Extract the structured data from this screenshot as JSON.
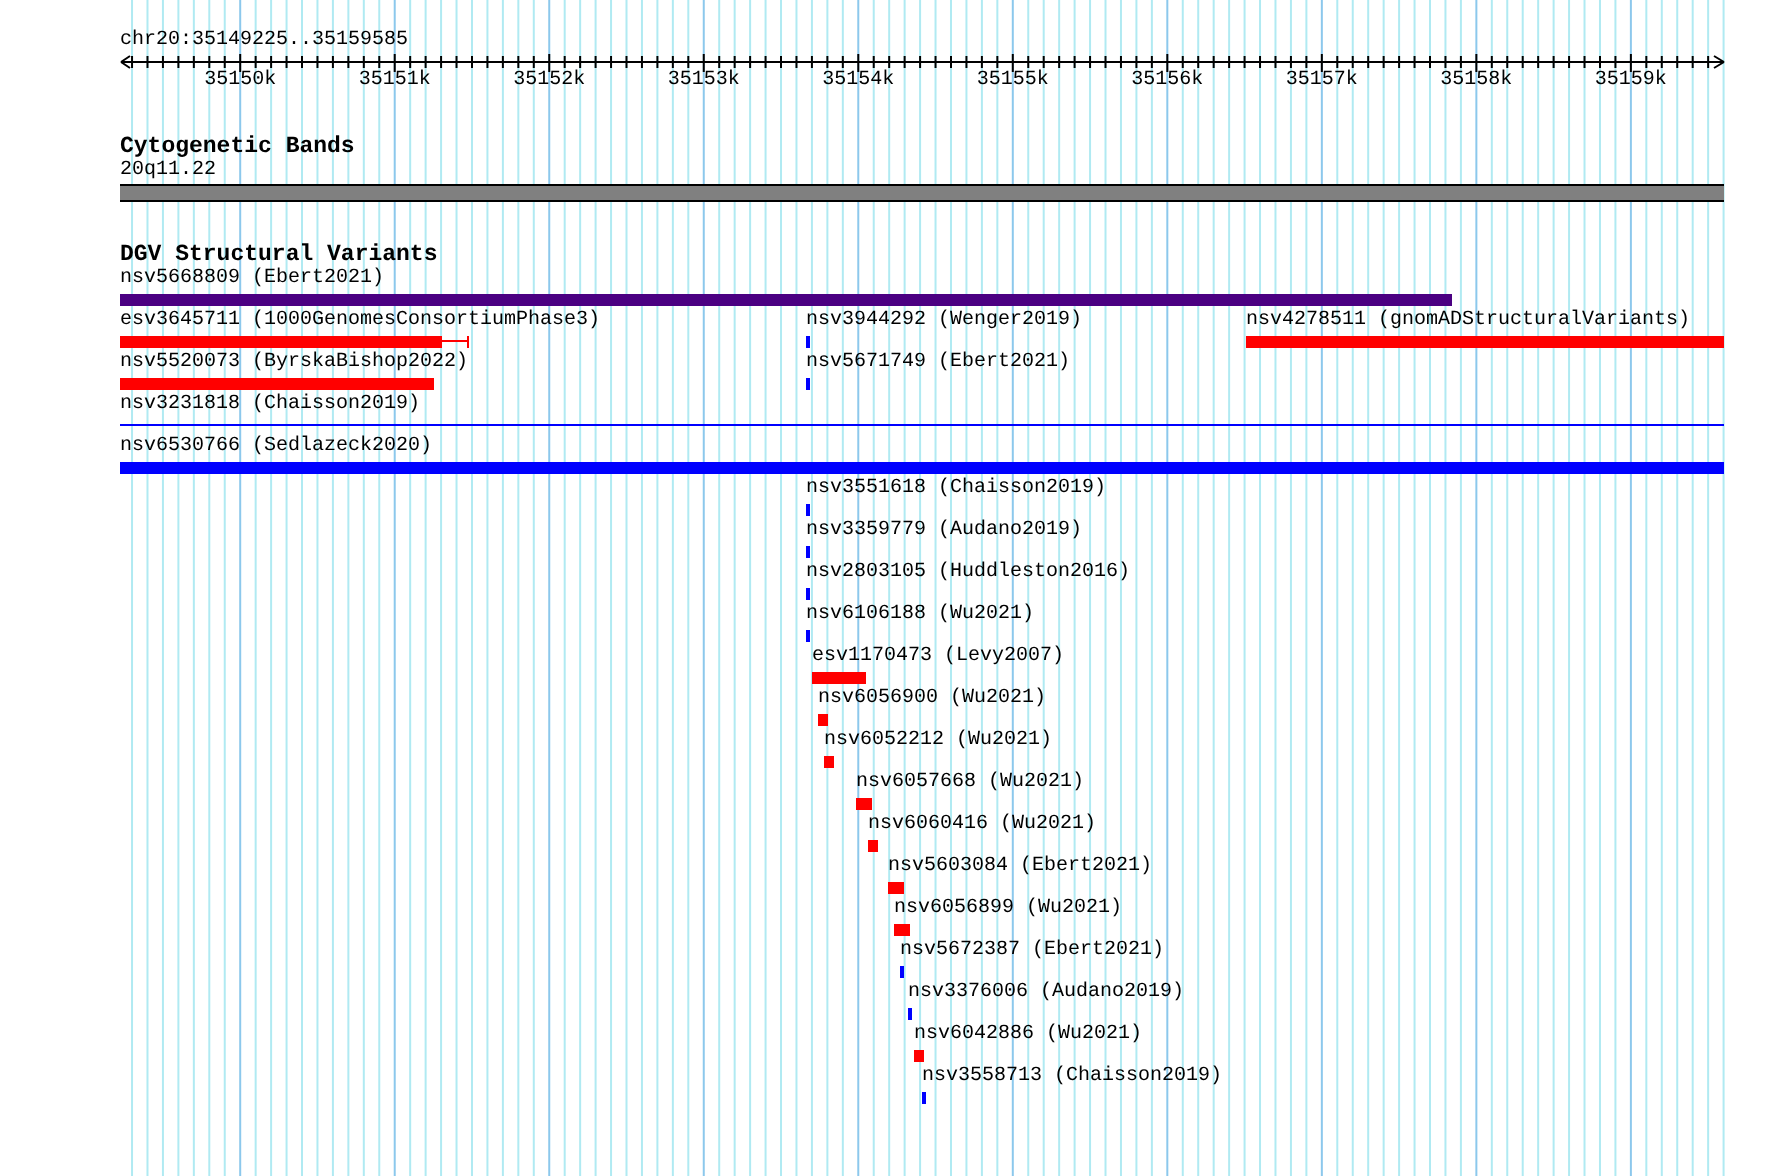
{
  "ruler": {
    "location": "chr20:35149225..35159585",
    "ticks": [
      "35150k",
      "35151k",
      "35152k",
      "35153k",
      "35154k",
      "35155k",
      "35156k",
      "35157k",
      "35158k",
      "35159k"
    ]
  },
  "tracks": [
    {
      "title": "Cytogenetic Bands",
      "kind": "bands",
      "features": [
        {
          "label": "20q11.22",
          "color": "#808080"
        }
      ]
    },
    {
      "title": "DGV Structural Variants",
      "kind": "variants",
      "features": [
        {
          "label": "nsv5668809 (Ebert2021)",
          "kind": "bar",
          "color": "#4b0082"
        },
        {
          "label": "esv3645711 (1000GenomesConsortiumPhase3)",
          "kind": "bar_whisker",
          "color": "#ff0000"
        },
        {
          "label": "nsv3944292 (Wenger2019)",
          "kind": "bar",
          "color": "#0000ff"
        },
        {
          "label": "nsv4278511 (gnomADStructuralVariants)",
          "kind": "bar",
          "color": "#ff0000"
        },
        {
          "label": "nsv5520073 (ByrskaBishop2022)",
          "kind": "bar",
          "color": "#ff0000"
        },
        {
          "label": "nsv5671749 (Ebert2021)",
          "kind": "bar",
          "color": "#0000ff"
        },
        {
          "label": "nsv3231818 (Chaisson2019)",
          "kind": "line",
          "color": "#0000ff"
        },
        {
          "label": "nsv6530766 (Sedlazeck2020)",
          "kind": "bar",
          "color": "#0000ff"
        },
        {
          "label": "nsv3551618 (Chaisson2019)",
          "kind": "bar",
          "color": "#0000ff"
        },
        {
          "label": "nsv3359779 (Audano2019)",
          "kind": "bar",
          "color": "#0000ff"
        },
        {
          "label": "nsv2803105 (Huddleston2016)",
          "kind": "bar",
          "color": "#0000ff"
        },
        {
          "label": "nsv6106188 (Wu2021)",
          "kind": "bar",
          "color": "#0000ff"
        },
        {
          "label": "esv1170473 (Levy2007)",
          "kind": "bar",
          "color": "#ff0000"
        },
        {
          "label": "nsv6056900 (Wu2021)",
          "kind": "bar",
          "color": "#ff0000"
        },
        {
          "label": "nsv6052212 (Wu2021)",
          "kind": "bar",
          "color": "#ff0000"
        },
        {
          "label": "nsv6057668 (Wu2021)",
          "kind": "bar",
          "color": "#ff0000"
        },
        {
          "label": "nsv6060416 (Wu2021)",
          "kind": "bar",
          "color": "#ff0000"
        },
        {
          "label": "nsv5603084 (Ebert2021)",
          "kind": "bar",
          "color": "#ff0000"
        },
        {
          "label": "nsv6056899 (Wu2021)",
          "kind": "bar",
          "color": "#ff0000"
        },
        {
          "label": "nsv5672387 (Ebert2021)",
          "kind": "bar",
          "color": "#0000ff"
        },
        {
          "label": "nsv3376006 (Audano2019)",
          "kind": "bar",
          "color": "#0000ff"
        },
        {
          "label": "nsv6042886 (Wu2021)",
          "kind": "bar",
          "color": "#ff0000"
        },
        {
          "label": "nsv3558713 (Chaisson2019)",
          "kind": "bar",
          "color": "#0000ff"
        }
      ]
    }
  ]
}
